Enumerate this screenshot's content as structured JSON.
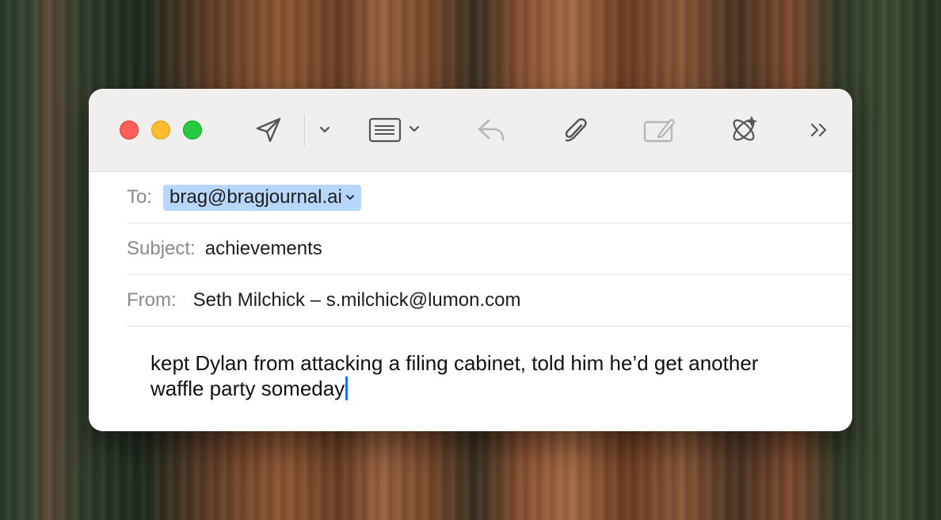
{
  "colors": {
    "accent": "#1a73e8",
    "chip": "#b7d6fb",
    "close": "#fe5f57",
    "minimize": "#febc2e",
    "maximize": "#28c840"
  },
  "toolbar": {
    "icons": [
      "send-icon",
      "chevron-down-icon",
      "header-fields-icon",
      "reply-icon",
      "paperclip-icon",
      "photo-browser-icon",
      "writing-tools-icon",
      "more-icon"
    ]
  },
  "compose": {
    "to_label": "To:",
    "to_value": "brag@bragjournal.ai",
    "subject_label": "Subject:",
    "subject_value": "achievements",
    "from_label": "From:",
    "from_value": "Seth Milchick – s.milchick@lumon.com",
    "body_line1": "kept Dylan from attacking a filing cabinet, told him he’d get another",
    "body_line2": "waffle party someday"
  }
}
